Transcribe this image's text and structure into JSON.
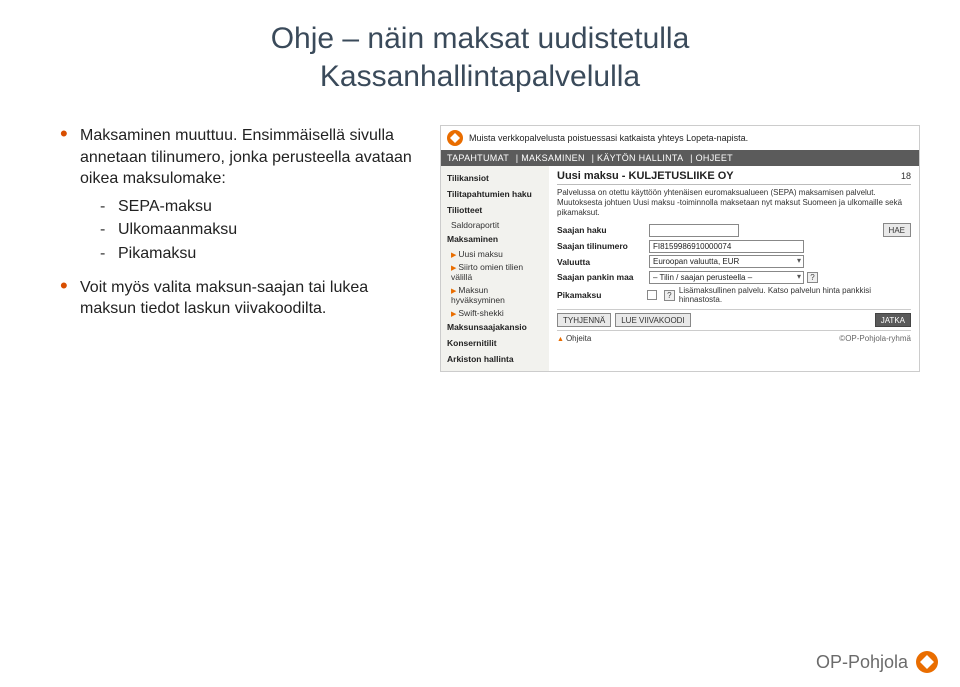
{
  "title_line1": "Ohje – näin maksat uudistetulla",
  "title_line2": "Kassanhallintapalvelulla",
  "left": {
    "bullet1": "Maksaminen muuttuu. Ensimmäisellä sivulla annetaan tilinumero, jonka perusteella avataan oikea maksulomake:",
    "sub1": "SEPA-maksu",
    "sub2": "Ulkomaanmaksu",
    "sub3": "Pikamaksu",
    "bullet2": "Voit myös valita maksun-saajan tai lukea maksun tiedot laskun viivakoodilta."
  },
  "mock": {
    "top_note": "Muista verkkopalvelusta poistuessasi katkaista yhteys Lopeta-napista.",
    "nav": [
      "TAPAHTUMAT",
      "MAKSAMINEN",
      "KÄYTÖN HALLINTA",
      "OHJEET"
    ],
    "sidebar": {
      "s1": "Tilikansiot",
      "s2": "Tilitapahtumien haku",
      "s3": "Tiliotteet",
      "s3a": "Saldoraportit",
      "s4": "Maksaminen",
      "s4a": "Uusi maksu",
      "s4b": "Siirto omien tilien välillä",
      "s4c": "Maksun hyväksyminen",
      "s4d": "Swift-shekki",
      "s5": "Maksunsaajakansio",
      "s6": "Konsernitilit",
      "s7": "Arkiston hallinta"
    },
    "heading": "Uusi maksu - KULJETUSLIIKE OY",
    "heading_num": "18",
    "desc": "Palvelussa on otettu käyttöön yhtenäisen euromaksualueen (SEPA) maksamisen palvelut. Muutoksesta johtuen Uusi maksu -toiminnolla maksetaan nyt maksut Suomeen ja ulkomaille sekä pikamaksut.",
    "rows": {
      "r1": "Saajan haku",
      "r1_btn": "HAE",
      "r2": "Saajan tilinumero",
      "r2_val": "FI8159986910000074",
      "r3": "Valuutta",
      "r3_val": "Euroopan valuutta, EUR",
      "r4": "Saajan pankin maa",
      "r4_val": "– Tilin / saajan perusteella –",
      "r5": "Pikamaksu",
      "r5_note": "Lisämaksullinen palvelu. Katso palvelun hinta pankkisi hinnastosta."
    },
    "actions": {
      "a1": "TYHJENNÄ",
      "a2": "LUE VIIVAKOODI",
      "a3": "JATKA"
    },
    "footer_left": "Ohjeita",
    "footer_right": "©OP-Pohjola-ryhmä"
  },
  "brand": "OP-Pohjola"
}
